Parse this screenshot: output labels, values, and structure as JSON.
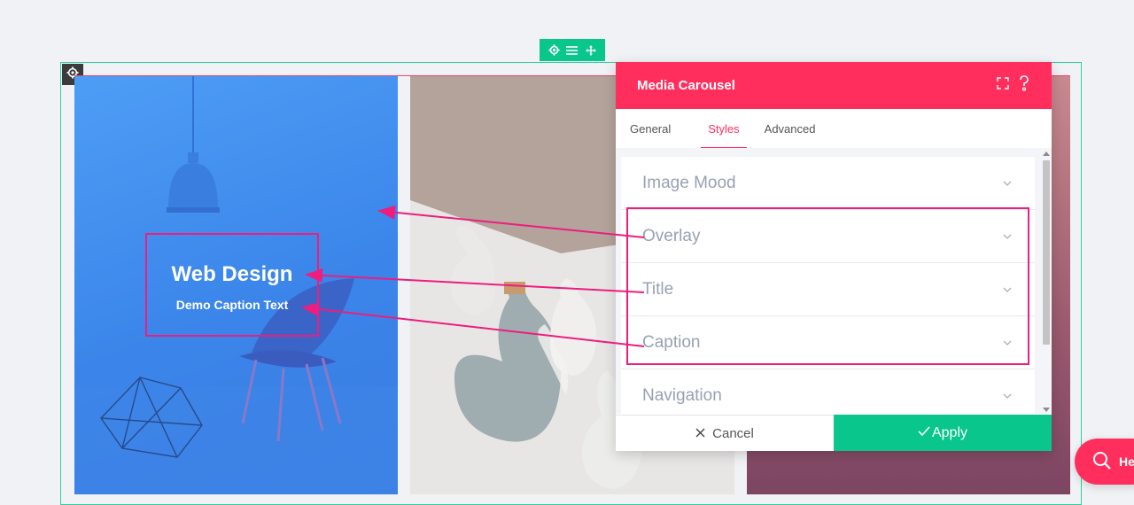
{
  "panel": {
    "title": "Media Carousel",
    "tabs": [
      "General",
      "Styles",
      "Advanced"
    ],
    "active_tab": "Styles",
    "sections": [
      "Image Mood",
      "Overlay",
      "Title",
      "Caption",
      "Navigation"
    ],
    "cancel_label": "Cancel",
    "apply_label": "Apply"
  },
  "slide": {
    "title": "Web Design",
    "caption": "Demo Caption Text"
  },
  "help": {
    "label": "He"
  },
  "colors": {
    "accent": "#ff2e5c",
    "apply": "#09c68d",
    "annotation": "#ee1d7e",
    "slide_blue": "#4492f0"
  },
  "icons": {
    "section_toolbar": [
      "gear-icon",
      "menu-icon",
      "move-icon"
    ],
    "row": "gear-icon",
    "panel_header": [
      "fullscreen-icon",
      "help-icon"
    ],
    "accordion": "chevron-down-icon",
    "cancel": "close-icon",
    "apply": "checkmark-icon",
    "help_button": "search-icon"
  }
}
